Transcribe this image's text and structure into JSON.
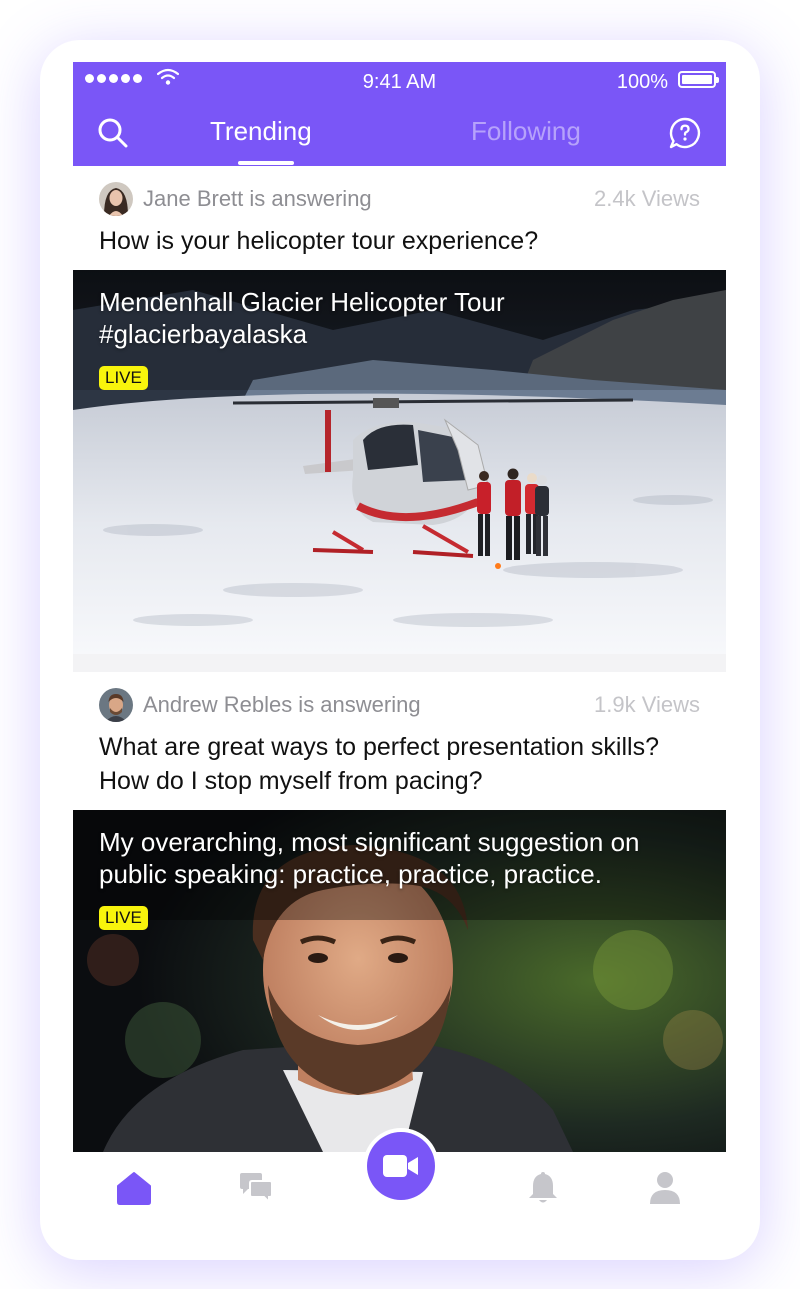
{
  "status_bar": {
    "time": "9:41 AM",
    "battery": "100%"
  },
  "nav": {
    "tab_trending": "Trending",
    "tab_following": "Following",
    "active_tab": "Trending"
  },
  "colors": {
    "brand": "#7a56f7",
    "live_badge": "#f8f40c"
  },
  "feed": [
    {
      "answerer": "Jane Brett is answering",
      "views": "2.4k Views",
      "question": "How is your helicopter tour experience?",
      "media_title": "Mendenhall Glacier Helicopter Tour #glacierbayalaska",
      "badge": "LIVE"
    },
    {
      "answerer": "Andrew Rebles is answering",
      "views": "1.9k Views",
      "question": "What are great ways to perfect presentation skills? How do I stop myself from pacing?",
      "media_title": "My overarching, most significant suggestion on public speaking: practice, practice, practice.",
      "badge": "LIVE"
    }
  ],
  "tabbar": {
    "items": [
      "home-icon",
      "chat-icon",
      "video-camera-icon",
      "bell-icon",
      "profile-icon"
    ],
    "active": "home-icon"
  }
}
